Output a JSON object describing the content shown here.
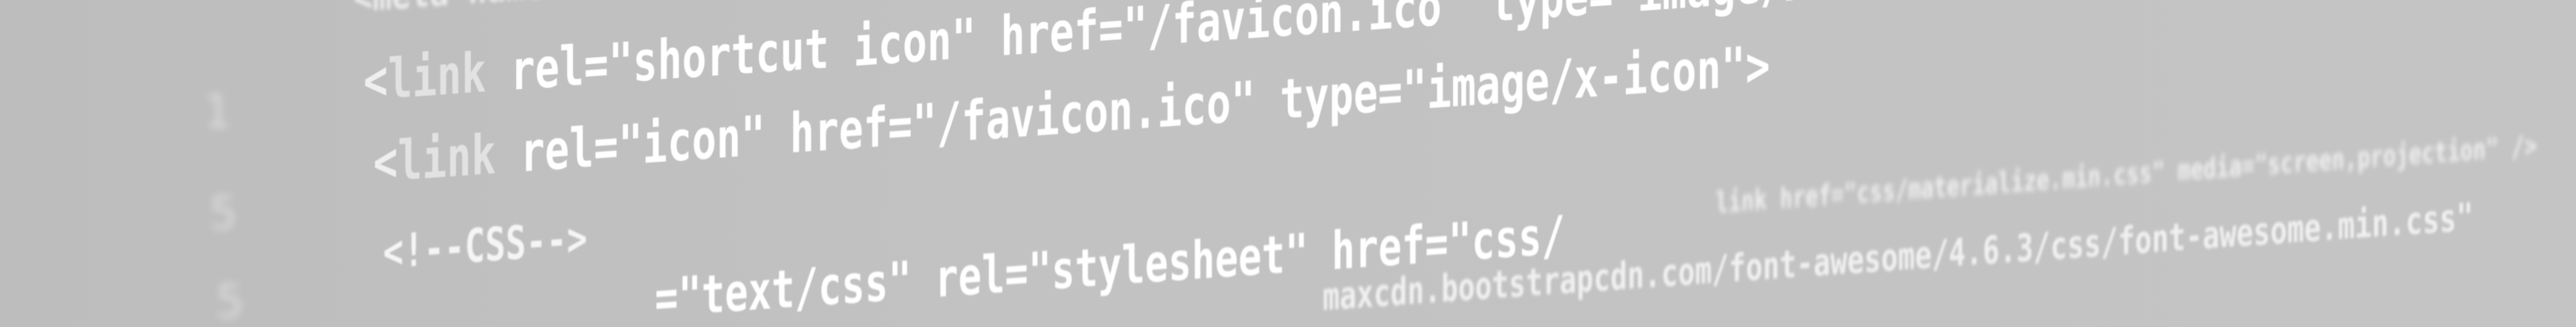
{
  "code_lines": {
    "line0": {
      "text": "<meta name=\"viewport\" content=\"width=device-width, initial-scale=1\">"
    },
    "line1": {
      "open": "<",
      "tag": "link",
      "attrs": " rel=\"shortcut icon\" href=\"/favicon.ico\" type=\"image/x-icon\">"
    },
    "line2": {
      "open": "<",
      "tag": "link",
      "attrs": " rel=\"icon\" href=\"/favicon.ico\" type=\"image/x-icon\">"
    },
    "line3": {
      "comment": "<!--CSS-->",
      "rest": "link href=\"css/materialize.min.css\" media=\"screen,projection\" />"
    },
    "line4": {
      "text": "=\"text/css\" rel=\"stylesheet\" href=\"css/",
      "rest": "maxcdn.bootstrapcdn.com/font-awesome/4.6.3/css/font-awesome.min.css\""
    }
  },
  "gutter": [
    "",
    "1",
    "5",
    "5"
  ]
}
